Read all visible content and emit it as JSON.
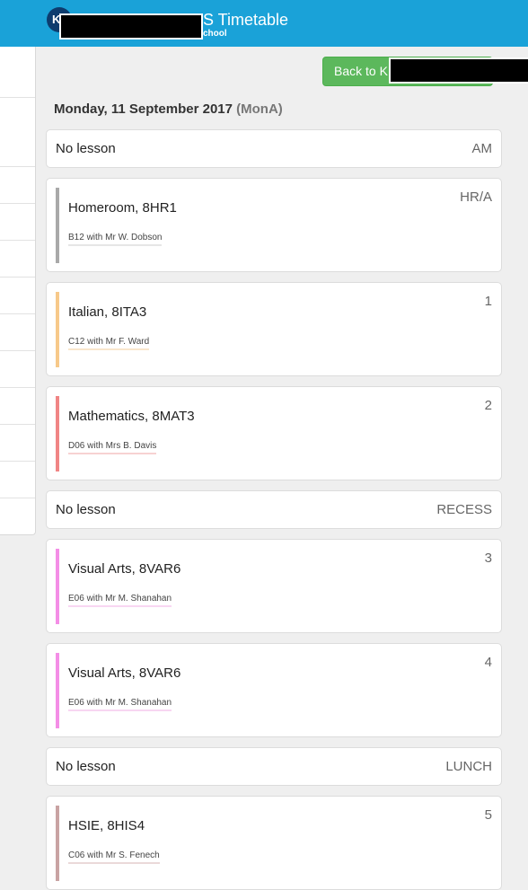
{
  "header": {
    "logo_text": "K",
    "title_suffix": "S Timetable",
    "subtitle_suffix": "chool"
  },
  "back_button": {
    "label": "Back to K"
  },
  "date": {
    "label": "Monday, 11 September 2017",
    "variant": "(MonA)"
  },
  "entries": [
    {
      "type": "nolesson",
      "label": "No lesson",
      "period": "AM"
    },
    {
      "type": "lesson",
      "subject": "Homeroom, 8HR1",
      "detail": "B12 with Mr W. Dobson",
      "period": "HR/A",
      "color": "#a9a9a9",
      "underline": "#e6e6e6"
    },
    {
      "type": "lesson",
      "subject": "Italian, 8ITA3",
      "detail": "C12 with Mr F. Ward",
      "period": "1",
      "color": "#f7c98a",
      "underline": "#f9e6cc"
    },
    {
      "type": "lesson",
      "subject": "Mathematics, 8MAT3",
      "detail": "D06 with Mrs B. Davis",
      "period": "2",
      "color": "#f08585",
      "underline": "#f7d2d2"
    },
    {
      "type": "nolesson",
      "label": "No lesson",
      "period": "RECESS"
    },
    {
      "type": "lesson",
      "subject": "Visual Arts, 8VAR6",
      "detail": "E06 with Mr M. Shanahan",
      "period": "3",
      "color": "#f48ee6",
      "underline": "#f8d6f2"
    },
    {
      "type": "lesson",
      "subject": "Visual Arts, 8VAR6",
      "detail": "E06 with Mr M. Shanahan",
      "period": "4",
      "color": "#f48ee6",
      "underline": "#f8d6f2"
    },
    {
      "type": "nolesson",
      "label": "No lesson",
      "period": "LUNCH"
    },
    {
      "type": "lesson",
      "subject": "HSIE, 8HIS4",
      "detail": "C06 with Mr S. Fenech",
      "period": "5",
      "color": "#c9a3a3",
      "underline": "#ead9d9"
    }
  ],
  "colors": {
    "header": "#1aa2d8",
    "back_button": "#5cb85c"
  }
}
